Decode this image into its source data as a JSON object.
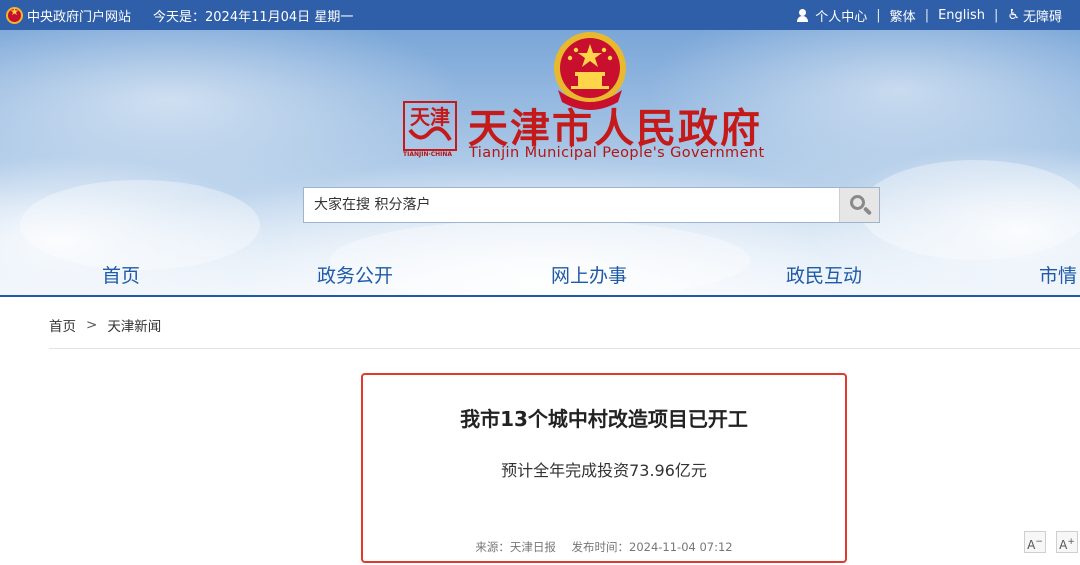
{
  "topbar": {
    "portal_link": "中央政府门户网站",
    "date_text": "今天是：2024年11月04日 星期一",
    "personal_center": "个人中心",
    "traditional": "繁体",
    "english": "English",
    "accessibility": "无障碍"
  },
  "header": {
    "title": "天津市人民政府",
    "subtitle": "Tianjin Municipal People's Government",
    "logo_mark_caption": "TIANJIN·CHINA",
    "logo_mark_text": "天津"
  },
  "search": {
    "placeholder": "大家在搜 积分落户"
  },
  "nav": {
    "items": [
      "首页",
      "政务公开",
      "网上办事",
      "政民互动",
      "市情"
    ]
  },
  "breadcrumb": {
    "home": "首页",
    "separator": ">",
    "current": "天津新闻"
  },
  "article": {
    "title": "我市13个城中村改造项目已开工",
    "subtitle": "预计全年完成投资73.96亿元",
    "source_label": "来源：天津日报",
    "publish_label": "发布时间：2024-11-04 07:12"
  },
  "font_controls": {
    "decrease": "A",
    "decrease_mark": "−",
    "increase": "A",
    "increase_mark": "+"
  },
  "colors": {
    "topbar": "#2f5fa8",
    "nav_text": "#1f5aa8",
    "brand_red": "#c41a1a",
    "highlight_border": "#e3392c"
  }
}
